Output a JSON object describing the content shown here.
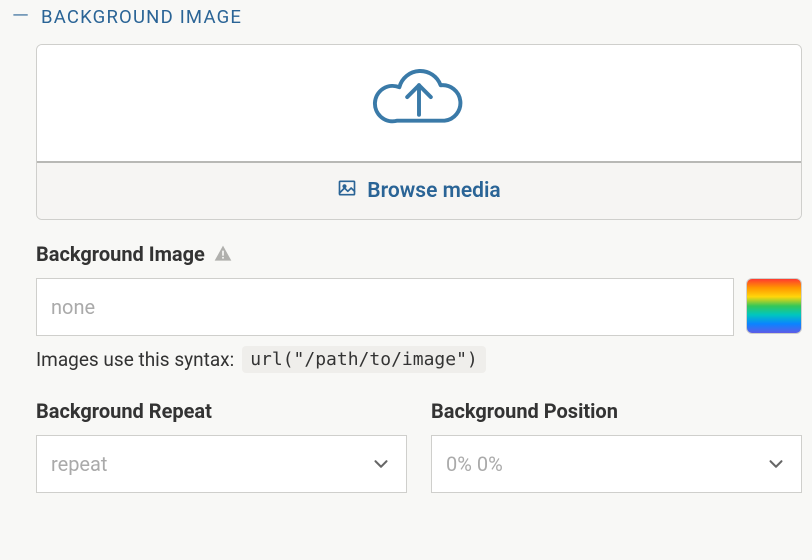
{
  "section": {
    "title": "BACKGROUND IMAGE",
    "collapse_glyph": "—"
  },
  "upload": {
    "browse_label": "Browse media"
  },
  "bg_image": {
    "label": "Background Image",
    "value": "",
    "placeholder": "none",
    "helper_prefix": "Images use this syntax:",
    "helper_code": "url(\"/path/to/image\")"
  },
  "bg_repeat": {
    "label": "Background Repeat",
    "value": "repeat"
  },
  "bg_position": {
    "label": "Background Position",
    "value": "0% 0%"
  }
}
